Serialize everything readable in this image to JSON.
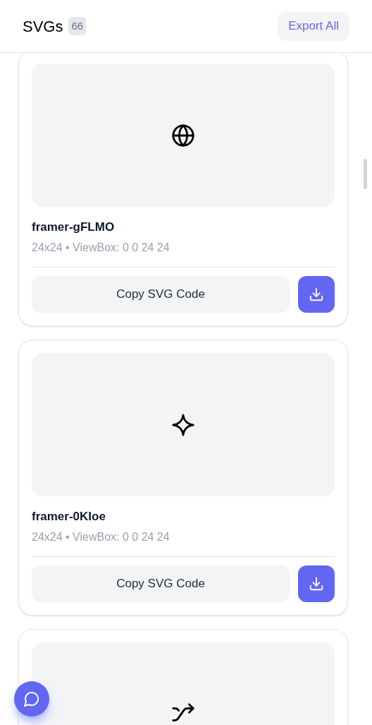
{
  "header": {
    "title": "SVGs",
    "count": "66",
    "export_button": "Export All"
  },
  "cards": [
    {
      "kind": "globe",
      "name": "framer-gFLMO",
      "meta": "24x24 • ViewBox: 0 0 24 24",
      "copy_button": "Copy SVG Code"
    },
    {
      "kind": "sparkle",
      "name": "framer-0KIoe",
      "meta": "24x24 • ViewBox: 0 0 24 24",
      "copy_button": "Copy SVG Code"
    },
    {
      "kind": "shuffle"
    }
  ]
}
